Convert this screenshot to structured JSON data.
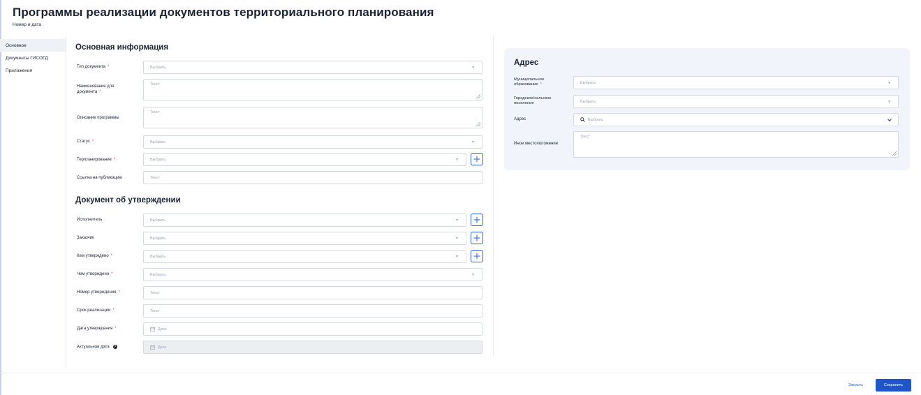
{
  "header": {
    "title": "Программы реализации документов территориального планирования",
    "subtitle": "Номер и дата"
  },
  "sidebar": {
    "items": [
      {
        "label": "Основное",
        "active": true
      },
      {
        "label": "Документы ГИСОГД",
        "active": false
      },
      {
        "label": "Приложения",
        "active": false
      }
    ]
  },
  "main_info": {
    "title": "Основная информация",
    "fields": {
      "doc_type": {
        "label": "Тип документа",
        "placeholder": "Выбрать"
      },
      "doc_name": {
        "label": "Наименование для документа",
        "placeholder": "Текст"
      },
      "program_desc": {
        "label": "Описание программы",
        "placeholder": "Текст"
      },
      "status": {
        "label": "Статус",
        "placeholder": "Выбрать"
      },
      "terplan": {
        "label": "Терпланирование",
        "placeholder": "Выбрать"
      },
      "pub_link": {
        "label": "Ссылка на публикацию",
        "placeholder": "Текст"
      }
    }
  },
  "approval_doc": {
    "title": "Документ об утверждении",
    "fields": {
      "executor": {
        "label": "Исполнитель",
        "placeholder": "Выбрать"
      },
      "customer": {
        "label": "Заказчик",
        "placeholder": "Выбрать"
      },
      "approved_by": {
        "label": "Кем утверждено",
        "placeholder": "Выбрать"
      },
      "approved_with": {
        "label": "Чем утверждено",
        "placeholder": "Выбрать"
      },
      "approval_number": {
        "label": "Номер утверждения",
        "placeholder": "Текст"
      },
      "impl_period": {
        "label": "Срок реализации",
        "placeholder": "Текст"
      },
      "approval_date": {
        "label": "Дата утверждения",
        "placeholder": "Дата"
      },
      "actual_date": {
        "label": "Актуальная дата",
        "placeholder": "Дата"
      }
    }
  },
  "address": {
    "title": "Адрес",
    "fields": {
      "municipality": {
        "label": "Муниципальное образование",
        "placeholder": "Выбрать"
      },
      "settlement": {
        "label": "Городское/сельское поселение",
        "placeholder": "Выбрать"
      },
      "address": {
        "label": "Адрес",
        "placeholder": "Выбрать"
      },
      "other_location": {
        "label": "Иное местоположение",
        "placeholder": "Текст"
      }
    }
  },
  "footer": {
    "close_label": "Закрыть",
    "save_label": "Сохранить"
  },
  "colors": {
    "primary": "#1f55c8",
    "required": "#e4483b",
    "panel_bg": "#f1f5fb"
  },
  "icons": {
    "plus": "plus-icon",
    "caret": "chevron-down-icon",
    "calendar": "calendar-icon",
    "search": "search-icon",
    "info": "info-icon"
  }
}
